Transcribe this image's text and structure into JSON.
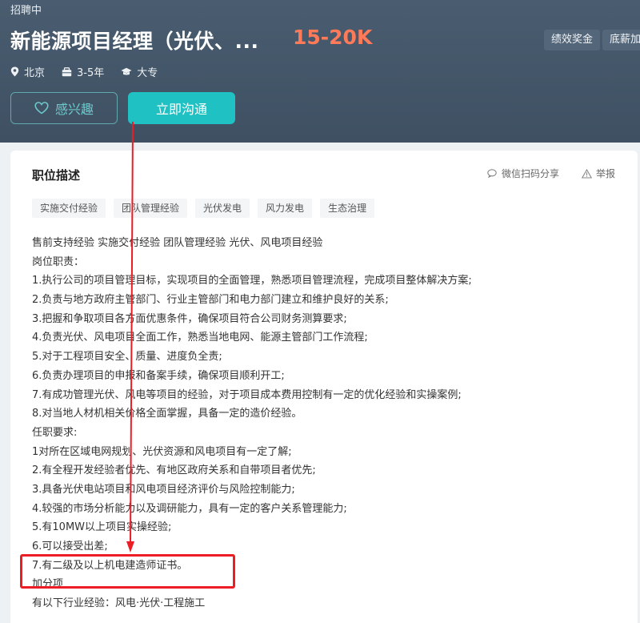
{
  "header": {
    "status": "招聘中",
    "title": "新能源项目经理（光伏、...",
    "salary": "15-20K",
    "benefits": [
      "绩效奖金",
      "底薪加"
    ],
    "meta": {
      "location": "北京",
      "experience": "3-5年",
      "education": "大专"
    },
    "like_label": "感兴趣",
    "chat_label": "立即沟通"
  },
  "colors": {
    "header_bg": "#4a5d70",
    "accent": "#1fc1c3",
    "salary": "#ff7a59",
    "highlight": "#ee1c25"
  },
  "section": {
    "title": "职位描述",
    "share_label": "微信扫码分享",
    "report_label": "举报",
    "tags": [
      "实施交付经验",
      "团队管理经验",
      "光伏发电",
      "风力发电",
      "生态治理"
    ]
  },
  "description": {
    "lines": [
      "售前支持经验   实施交付经验    团队管理经验   光伏、风电项目经验",
      "岗位职责：",
      "1.执行公司的项目管理目标，实现项目的全面管理，熟悉项目管理流程，完成项目整体解决方案;",
      "2.负责与地方政府主管部门、行业主管部门和电力部门建立和维护良好的关系;",
      "3.把握和争取项目各方面优惠条件，确保项目符合公司财务测算要求;",
      "4.负责光伏、风电项目全面工作，熟悉当地电网、能源主管部门工作流程;",
      "5.对于工程项目安全、质量、进度负全责;",
      "6.负责办理项目的申报和备案手续，确保项目顺利开工;",
      "7.有成功管理光伏、风电等项目的经验，对于项目成本费用控制有一定的优化经验和实操案例;",
      "8.对当地人材机相关价格全面掌握，具备一定的造价经验。",
      "任职要求:",
      "1对所在区域电网规划、光伏资源和风电项目有一定了解;",
      "2.有全程开发经验者优先、有地区政府关系和自带项目者优先;",
      "3.具备光伏电站项目和风电项目经济评价与风险控制能力;",
      "4.较强的市场分析能力以及调研能力，具有一定的客户关系管理能力;",
      "5.有10MW以上项目实操经验;",
      "6.可以接受出差;",
      "7.有二级及以上机电建造师证书。",
      "加分项",
      "有以下行业经验：风电·光伏·工程施工"
    ]
  }
}
